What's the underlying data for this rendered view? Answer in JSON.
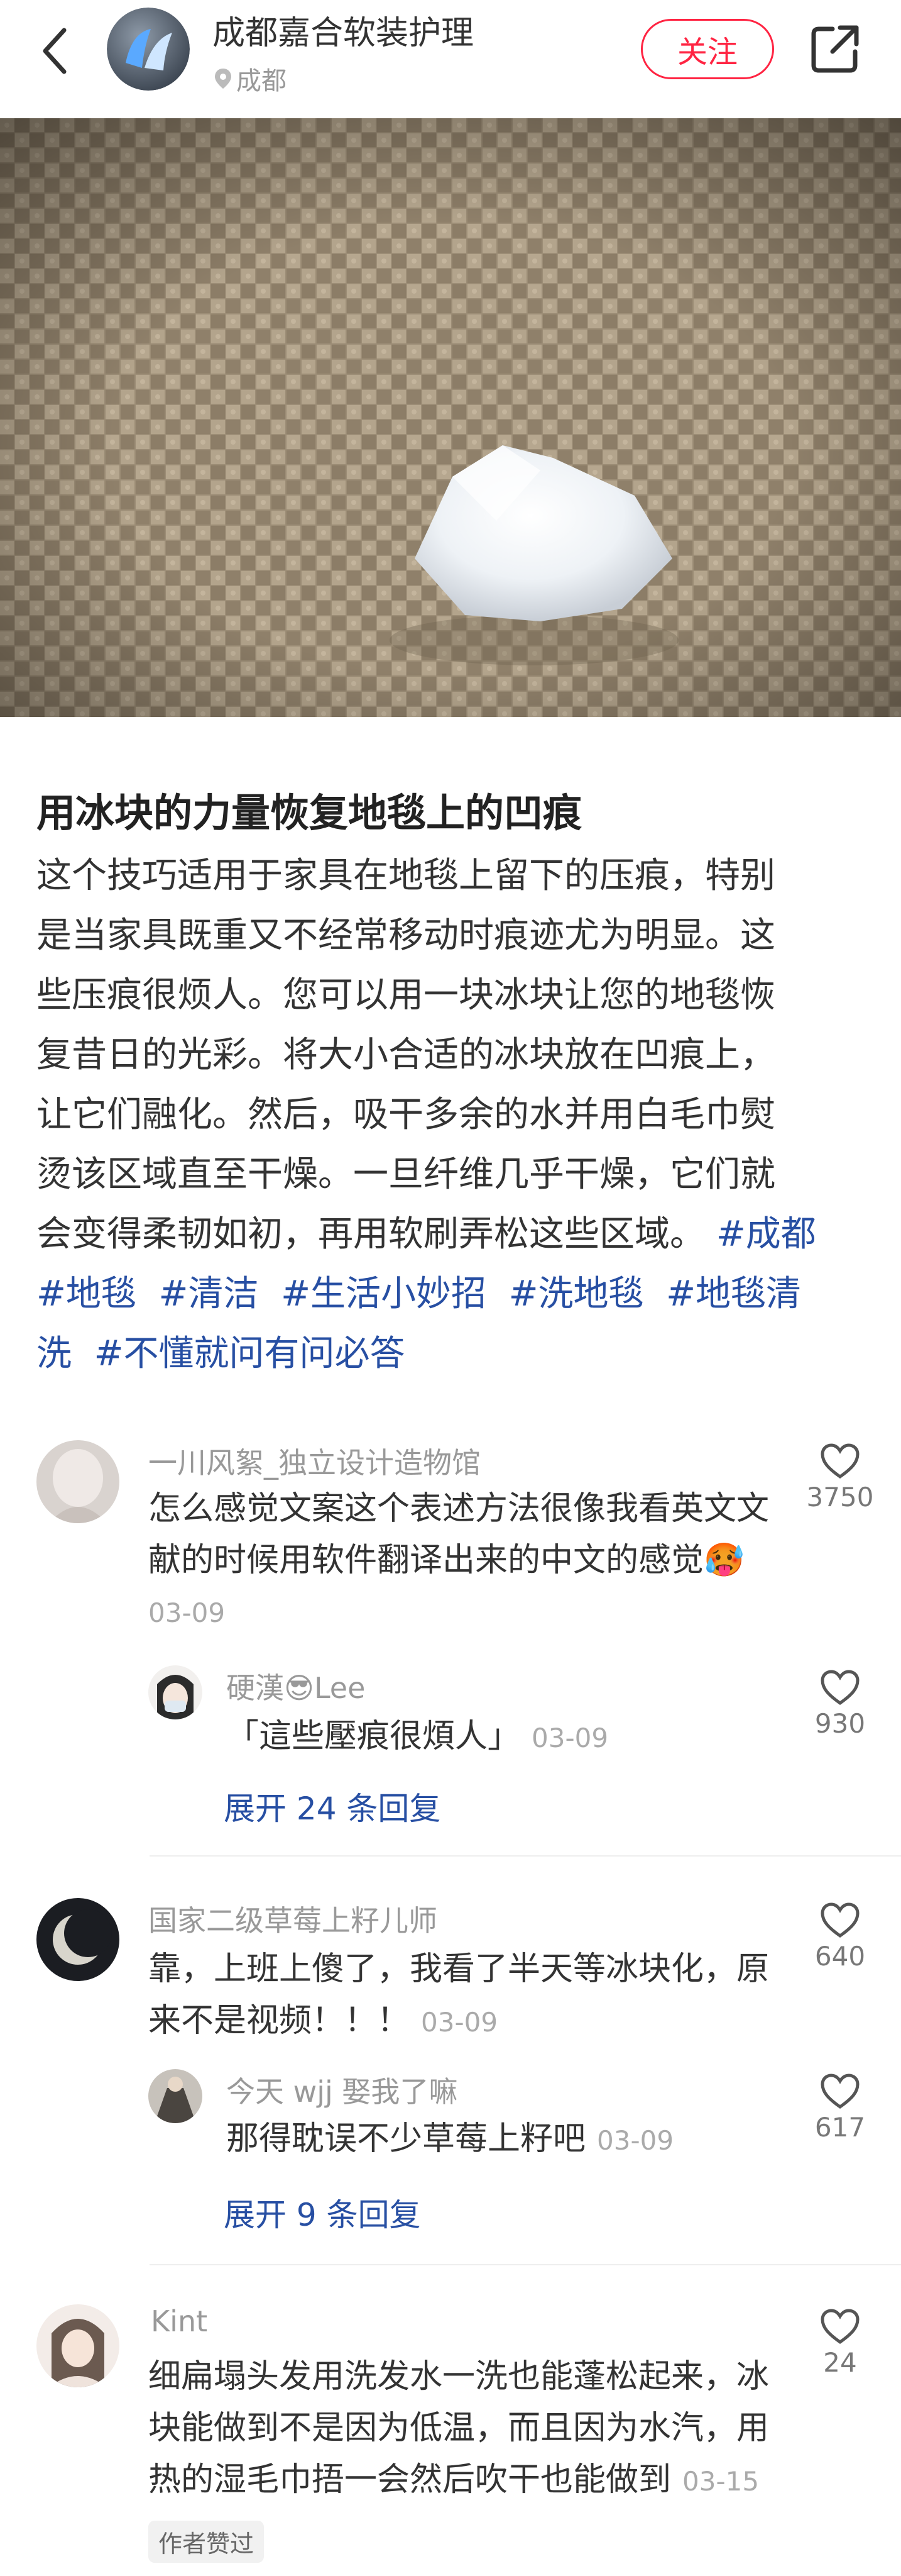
{
  "header": {
    "author": "成都嘉合软装护理",
    "location": "成都",
    "follow": "关注",
    "icons": [
      "back-arrow-icon",
      "share-icon",
      "location-pin-icon"
    ]
  },
  "post": {
    "title": "用冰块的力量恢复地毯上的凹痕",
    "lines": [
      "这个技巧适用于家具在地毯上留下的压痕，特别",
      "是当家具既重又不经常移动时痕迹尤为明显。这",
      "些压痕很烦人。您可以用一块冰块让您的地毯恢",
      "复昔日的光彩。将大小合适的冰块放在凹痕上，",
      "让它们融化。然后，吸干多余的水并用白毛巾熨",
      "烫该区域直至干燥。一旦纤维几乎干燥，它们就",
      "会变得柔韧如初，再用软刷弄松这些区域。"
    ],
    "tags": [
      "#成都",
      "#地毯",
      "#清洁",
      "#生活小妙招",
      "#洗地毯",
      "#地毯清洗",
      "#不懂就问有问必答"
    ],
    "tag_line2": [
      "#地毯",
      "#清洁",
      "#生活小妙招",
      "#洗地毯",
      "#地毯清"
    ],
    "tag_line3_a": "洗",
    "tag_line3_b": "#不懂就问有问必答"
  },
  "comments": [
    {
      "name": "一川风絮_独立设计造物馆",
      "lines": [
        "怎么感觉文案这个表述方法很像我看英文文",
        "献的时候用软件翻译出来的中文的感觉🥵"
      ],
      "date": "03-09",
      "likes": "3750",
      "reply": {
        "name_a": "硬漢",
        "emoji": "😎",
        "name_b": "Lee",
        "text": "「這些壓痕很煩人」",
        "date": "03-09",
        "likes": "930"
      },
      "expand": "展开 24 条回复"
    },
    {
      "name": "国家二级草莓上籽儿师",
      "lines": [
        "靠，上班上傻了，我看了半天等冰块化，原",
        "来不是视频！！！"
      ],
      "date": "03-09",
      "likes": "640",
      "reply": {
        "name": "今天 wjj 娶我了嘛",
        "text": "那得耽误不少草莓上籽吧",
        "date": "03-09",
        "likes": "617"
      },
      "expand": "展开 9 条回复"
    },
    {
      "name": "Kint",
      "lines": [
        "细扁塌头发用洗发水一洗也能蓬松起来，冰",
        "块能做到不是因为低温，而且因为水汽，用",
        "热的湿毛巾捂一会然后吹干也能做到"
      ],
      "date": "03-15",
      "likes": "24",
      "badge": "作者赞过"
    }
  ]
}
